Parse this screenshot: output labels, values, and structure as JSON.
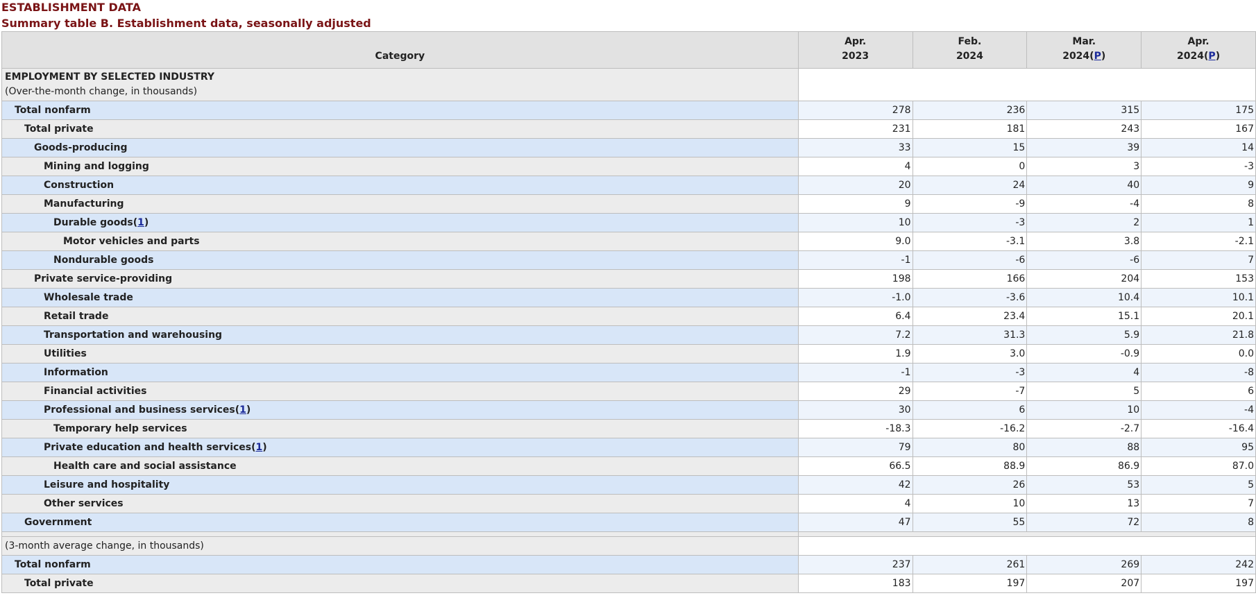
{
  "page": {
    "title": "ESTABLISHMENT DATA",
    "subtitle": "Summary table B. Establishment data, seasonally adjusted"
  },
  "table": {
    "category_header": "Category",
    "columns": [
      {
        "line1": "Apr.",
        "line2": "2023",
        "footnote": ""
      },
      {
        "line1": "Feb.",
        "line2": "2024",
        "footnote": ""
      },
      {
        "line1": "Mar.",
        "line2": "2024",
        "footnote": "P"
      },
      {
        "line1": "Apr.",
        "line2": "2024",
        "footnote": "P"
      }
    ],
    "section1": {
      "line1": "EMPLOYMENT BY SELECTED INDUSTRY",
      "line2": "(Over-the-month change, in thousands)"
    },
    "rows": [
      {
        "label": "Total nonfarm",
        "footnote": "",
        "values": [
          "278",
          "236",
          "315",
          "175"
        ]
      },
      {
        "label": "Total private",
        "footnote": "",
        "values": [
          "231",
          "181",
          "243",
          "167"
        ]
      },
      {
        "label": "Goods-producing",
        "footnote": "",
        "values": [
          "33",
          "15",
          "39",
          "14"
        ]
      },
      {
        "label": "Mining and logging",
        "footnote": "",
        "values": [
          "4",
          "0",
          "3",
          "-3"
        ]
      },
      {
        "label": "Construction",
        "footnote": "",
        "values": [
          "20",
          "24",
          "40",
          "9"
        ]
      },
      {
        "label": "Manufacturing",
        "footnote": "",
        "values": [
          "9",
          "-9",
          "-4",
          "8"
        ]
      },
      {
        "label": "Durable goods",
        "footnote": "1",
        "values": [
          "10",
          "-3",
          "2",
          "1"
        ]
      },
      {
        "label": "Motor vehicles and parts",
        "footnote": "",
        "values": [
          "9.0",
          "-3.1",
          "3.8",
          "-2.1"
        ]
      },
      {
        "label": "Nondurable goods",
        "footnote": "",
        "values": [
          "-1",
          "-6",
          "-6",
          "7"
        ]
      },
      {
        "label": "Private service-providing",
        "footnote": "",
        "values": [
          "198",
          "166",
          "204",
          "153"
        ]
      },
      {
        "label": "Wholesale trade",
        "footnote": "",
        "values": [
          "-1.0",
          "-3.6",
          "10.4",
          "10.1"
        ]
      },
      {
        "label": "Retail trade",
        "footnote": "",
        "values": [
          "6.4",
          "23.4",
          "15.1",
          "20.1"
        ]
      },
      {
        "label": "Transportation and warehousing",
        "footnote": "",
        "values": [
          "7.2",
          "31.3",
          "5.9",
          "21.8"
        ]
      },
      {
        "label": "Utilities",
        "footnote": "",
        "values": [
          "1.9",
          "3.0",
          "-0.9",
          "0.0"
        ]
      },
      {
        "label": "Information",
        "footnote": "",
        "values": [
          "-1",
          "-3",
          "4",
          "-8"
        ]
      },
      {
        "label": "Financial activities",
        "footnote": "",
        "values": [
          "29",
          "-7",
          "5",
          "6"
        ]
      },
      {
        "label": "Professional and business services",
        "footnote": "1",
        "values": [
          "30",
          "6",
          "10",
          "-4"
        ]
      },
      {
        "label": "Temporary help services",
        "footnote": "",
        "values": [
          "-18.3",
          "-16.2",
          "-2.7",
          "-16.4"
        ]
      },
      {
        "label": "Private education and health services",
        "footnote": "1",
        "values": [
          "79",
          "80",
          "88",
          "95"
        ]
      },
      {
        "label": "Health care and social assistance",
        "footnote": "",
        "values": [
          "66.5",
          "88.9",
          "86.9",
          "87.0"
        ]
      },
      {
        "label": "Leisure and hospitality",
        "footnote": "",
        "values": [
          "42",
          "26",
          "53",
          "5"
        ]
      },
      {
        "label": "Other services",
        "footnote": "",
        "values": [
          "4",
          "10",
          "13",
          "7"
        ]
      },
      {
        "label": "Government",
        "footnote": "",
        "values": [
          "47",
          "55",
          "72",
          "8"
        ]
      }
    ],
    "section2": {
      "line1": "(3-month average change, in thousands)"
    },
    "avg_rows": [
      {
        "label": "Total nonfarm",
        "footnote": "",
        "values": [
          "237",
          "261",
          "269",
          "242"
        ]
      },
      {
        "label": "Total private",
        "footnote": "",
        "values": [
          "183",
          "197",
          "207",
          "197"
        ]
      }
    ]
  }
}
